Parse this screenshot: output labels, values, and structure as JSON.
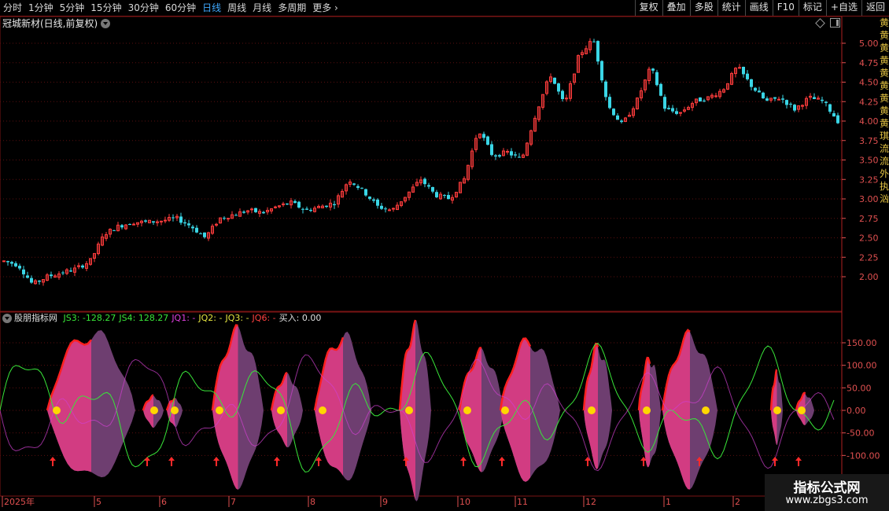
{
  "toolbar": {
    "periods": [
      "分时",
      "1分钟",
      "5分钟",
      "15分钟",
      "30分钟",
      "60分钟",
      "日线",
      "周线",
      "月线",
      "多周期",
      "更多"
    ],
    "active_period": "日线",
    "more_chevron_icon": "chevron-right-icon",
    "right_buttons": [
      "复权",
      "叠加",
      "多股",
      "统计",
      "画线",
      "F10",
      "标记",
      "+自选",
      "返回"
    ]
  },
  "stock_title": "冠城新材(日线,前复权)",
  "indicator": {
    "name": "股朋指标网",
    "items": [
      {
        "label": "JS3: -128.27",
        "color": "#39e639"
      },
      {
        "label": "JS4: 128.27",
        "color": "#39e639"
      },
      {
        "label": "JQ1: -",
        "color": "#e040e0"
      },
      {
        "label": "JQ2: -",
        "color": "#e6e640"
      },
      {
        "label": "JQ3: -",
        "color": "#e6e640"
      },
      {
        "label": "JQ6: -",
        "color": "#ff4040"
      },
      {
        "label": "买入: 0.00",
        "color": "#e0e0e0"
      }
    ]
  },
  "price_axis_labels": [
    "5.00",
    "4.75",
    "4.50",
    "4.25",
    "4.00",
    "3.75",
    "3.50",
    "3.25",
    "3.00",
    "2.75",
    "2.50",
    "2.25",
    "2.00"
  ],
  "indicator_axis_labels": [
    "150.00",
    "100.00",
    "50.00",
    "0.00",
    "-50.00",
    "-100.00"
  ],
  "date_axis": [
    "2025年",
    "5",
    "6",
    "7",
    "8",
    "9",
    "10",
    "11",
    "12",
    "1",
    "2"
  ],
  "right_edge_chars": [
    "黄",
    "黄",
    "黄",
    "黄",
    "黄",
    "黄",
    "黄",
    "黄",
    "黄",
    "琪",
    "流",
    "流",
    "外",
    "执",
    "汹"
  ],
  "watermark": {
    "title": "指标公式网",
    "url": "www.zbgs3.com"
  },
  "colors": {
    "up": "#ff3c3c",
    "down": "#3ad6e6",
    "grid": "#5a0f0f",
    "axis": "#e05050",
    "pink": "#d23c82",
    "purple": "#6e3e70",
    "green_line": "#39e639",
    "magenta_line": "#d040d0",
    "signal": "#ffd700"
  },
  "chart_data": [
    {
      "type": "candlestick",
      "title": "冠城新材(日线,前复权)",
      "ylim": [
        1.8,
        5.2
      ],
      "x_range": [
        "2025-04",
        "2026-02"
      ],
      "close_path_approx": [
        2.2,
        2.15,
        1.9,
        2.0,
        2.05,
        2.1,
        2.2,
        2.55,
        2.65,
        2.7,
        2.7,
        2.72,
        2.75,
        2.65,
        2.5,
        2.75,
        2.8,
        2.85,
        2.82,
        2.9,
        2.95,
        2.85,
        2.9,
        2.95,
        3.25,
        3.1,
        2.9,
        2.85,
        3.05,
        3.25,
        3.05,
        3.0,
        3.25,
        3.9,
        3.55,
        3.6,
        3.5,
        4.1,
        4.6,
        4.2,
        4.85,
        5.05,
        4.2,
        3.95,
        4.25,
        4.7,
        4.15,
        4.1,
        4.25,
        4.3,
        4.4,
        4.7,
        4.45,
        4.25,
        4.3,
        4.15,
        4.3,
        4.25,
        4.0
      ]
    },
    {
      "type": "area",
      "name": "股朋指标网",
      "ylim": [
        -160,
        170
      ],
      "series": [
        {
          "name": "JS3",
          "values": [
            -128.27
          ]
        },
        {
          "name": "JS4",
          "values": [
            128.27
          ]
        },
        {
          "name": "买入",
          "values": [
            0.0
          ]
        }
      ],
      "signal_count": 14
    }
  ]
}
